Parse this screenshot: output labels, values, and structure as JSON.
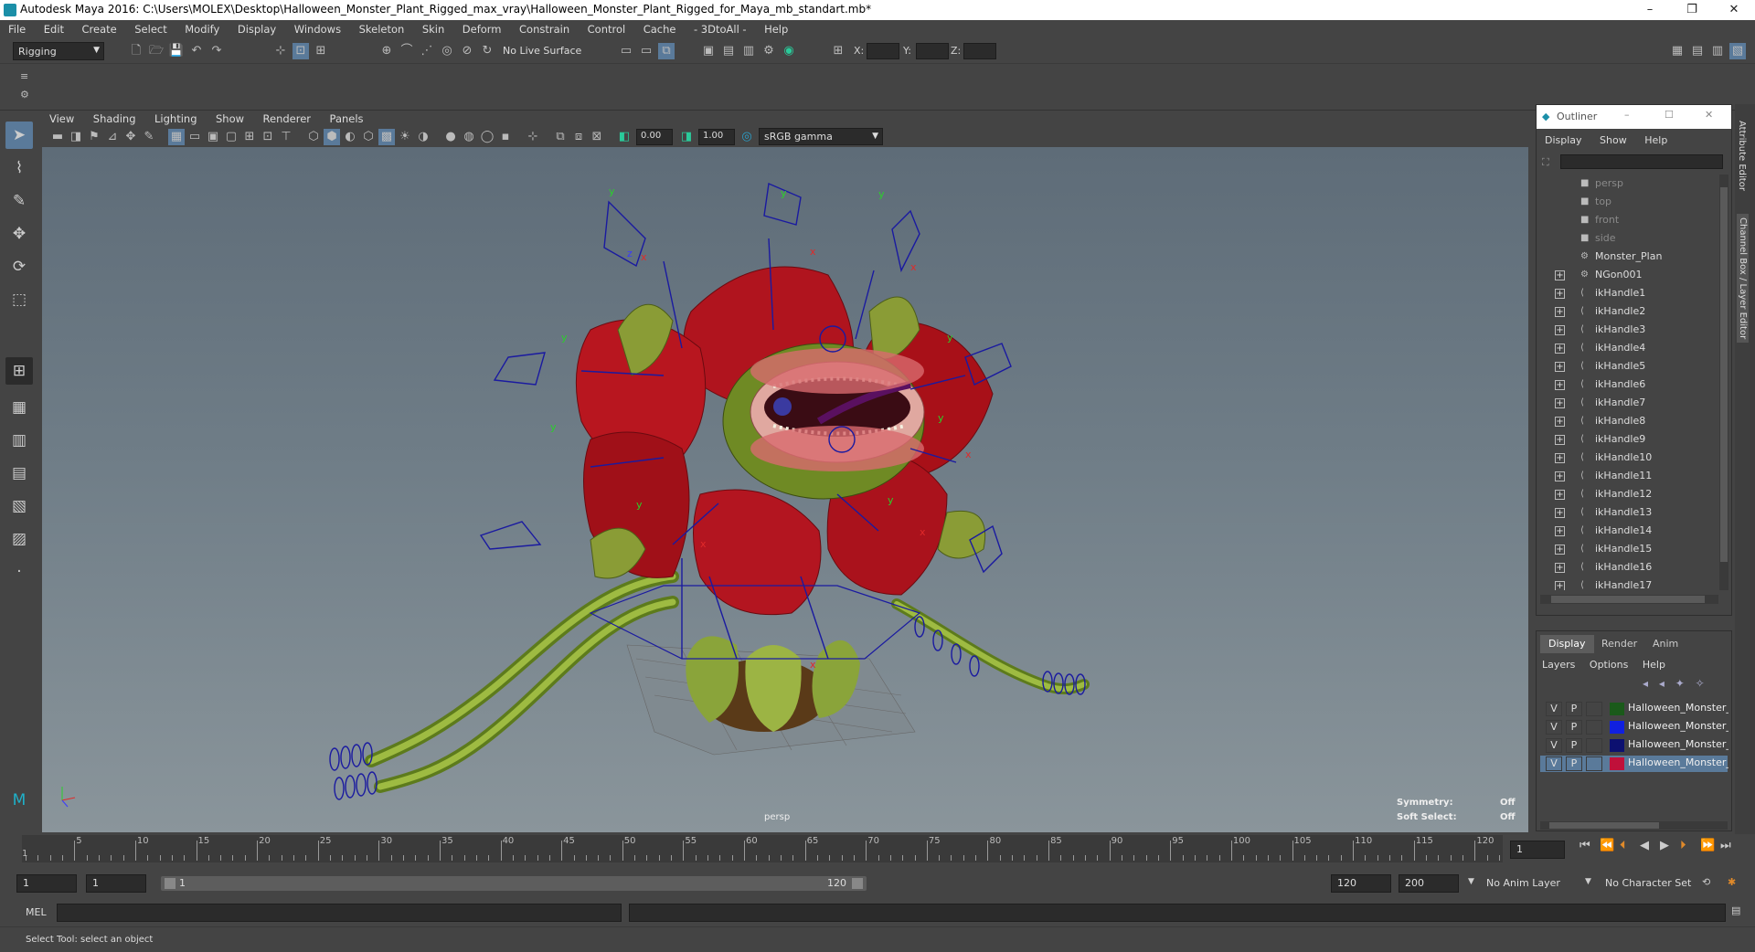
{
  "window": {
    "title": "Autodesk Maya 2016: C:\\Users\\MOLEX\\Desktop\\Halloween_Monster_Plant_Rigged_max_vray\\Halloween_Monster_Plant_Rigged_for_Maya_mb_standart.mb*",
    "minimize": "–",
    "maximize": "❐",
    "close": "✕"
  },
  "menubar": [
    "File",
    "Edit",
    "Create",
    "Select",
    "Modify",
    "Display",
    "Windows",
    "Skeleton",
    "Skin",
    "Deform",
    "Constrain",
    "Control",
    "Cache",
    "- 3DtoAll -",
    "Help"
  ],
  "statusline": {
    "menuset": "Rigging",
    "live_surface": "No Live Surface",
    "x_label": "X:",
    "y_label": "Y:",
    "z_label": "Z:"
  },
  "panel": {
    "menus": [
      "View",
      "Shading",
      "Lighting",
      "Show",
      "Renderer",
      "Panels"
    ],
    "near_value": "0.00",
    "far_value": "1.00",
    "colorspace": "sRGB gamma",
    "camera_label": "persp",
    "symmetry_label": "Symmetry:",
    "symmetry_value": "Off",
    "softselect_label": "Soft Select:",
    "softselect_value": "Off"
  },
  "outliner": {
    "title": "Outliner",
    "menus": [
      "Display",
      "Show",
      "Help"
    ],
    "items": [
      {
        "label": "persp",
        "dim": true,
        "expand": false,
        "icon": "camera-icon"
      },
      {
        "label": "top",
        "dim": true,
        "expand": false,
        "icon": "camera-icon"
      },
      {
        "label": "front",
        "dim": true,
        "expand": false,
        "icon": "camera-icon"
      },
      {
        "label": "side",
        "dim": true,
        "expand": false,
        "icon": "camera-icon"
      },
      {
        "label": "Monster_Plan",
        "dim": false,
        "expand": false,
        "icon": "transform-icon"
      },
      {
        "label": "NGon001",
        "dim": false,
        "expand": true,
        "icon": "transform-icon"
      },
      {
        "label": "ikHandle1",
        "dim": false,
        "expand": true,
        "icon": "ik-handle-icon"
      },
      {
        "label": "ikHandle2",
        "dim": false,
        "expand": true,
        "icon": "ik-handle-icon"
      },
      {
        "label": "ikHandle3",
        "dim": false,
        "expand": true,
        "icon": "ik-handle-icon"
      },
      {
        "label": "ikHandle4",
        "dim": false,
        "expand": true,
        "icon": "ik-handle-icon"
      },
      {
        "label": "ikHandle5",
        "dim": false,
        "expand": true,
        "icon": "ik-handle-icon"
      },
      {
        "label": "ikHandle6",
        "dim": false,
        "expand": true,
        "icon": "ik-handle-icon"
      },
      {
        "label": "ikHandle7",
        "dim": false,
        "expand": true,
        "icon": "ik-handle-icon"
      },
      {
        "label": "ikHandle8",
        "dim": false,
        "expand": true,
        "icon": "ik-handle-icon"
      },
      {
        "label": "ikHandle9",
        "dim": false,
        "expand": true,
        "icon": "ik-handle-icon"
      },
      {
        "label": "ikHandle10",
        "dim": false,
        "expand": true,
        "icon": "ik-handle-icon"
      },
      {
        "label": "ikHandle11",
        "dim": false,
        "expand": true,
        "icon": "ik-handle-icon"
      },
      {
        "label": "ikHandle12",
        "dim": false,
        "expand": true,
        "icon": "ik-handle-icon"
      },
      {
        "label": "ikHandle13",
        "dim": false,
        "expand": true,
        "icon": "ik-handle-icon"
      },
      {
        "label": "ikHandle14",
        "dim": false,
        "expand": true,
        "icon": "ik-handle-icon"
      },
      {
        "label": "ikHandle15",
        "dim": false,
        "expand": true,
        "icon": "ik-handle-icon"
      },
      {
        "label": "ikHandle16",
        "dim": false,
        "expand": true,
        "icon": "ik-handle-icon"
      },
      {
        "label": "ikHandle17",
        "dim": false,
        "expand": true,
        "icon": "ik-handle-icon"
      }
    ]
  },
  "dock_tabs": [
    "Attribute Editor",
    "Channel Box / Layer Editor"
  ],
  "layer_editor": {
    "tabs": [
      "Display",
      "Render",
      "Anim"
    ],
    "menus": [
      "Layers",
      "Options",
      "Help"
    ],
    "layers": [
      {
        "v": "V",
        "p": "P",
        "color": "#1a5a1a",
        "name": "Halloween_Monster_P",
        "selected": false
      },
      {
        "v": "V",
        "p": "P",
        "color": "#1020e0",
        "name": "Halloween_Monster_P",
        "selected": false
      },
      {
        "v": "V",
        "p": "P",
        "color": "#0c1070",
        "name": "Halloween_Monster_P",
        "selected": false
      },
      {
        "v": "V",
        "p": "P",
        "color": "#c0103a",
        "name": "Halloween_Monster_P",
        "selected": true
      }
    ]
  },
  "timeslider": {
    "ticks": [
      "5",
      "10",
      "15",
      "20",
      "25",
      "30",
      "35",
      "40",
      "45",
      "50",
      "55",
      "60",
      "65",
      "70",
      "75",
      "80",
      "85",
      "90",
      "95",
      "100",
      "105",
      "110",
      "115",
      "120"
    ],
    "first_label": "1",
    "current_frame": "1"
  },
  "rangeslider": {
    "start": "1",
    "playback_start": "1",
    "range_start_label": "1",
    "range_end_label": "120",
    "playback_end": "120",
    "end": "200",
    "anim_layer": "No Anim Layer",
    "character_set": "No Character Set"
  },
  "cmdline": {
    "label": "MEL"
  },
  "helpline": {
    "text": "Select Tool: select an object"
  },
  "colors": {
    "accent": "#5a7a9a",
    "plant_red": "#b0141e",
    "plant_green": "#7d9a2c",
    "rig_blue": "#1a1aa0"
  }
}
